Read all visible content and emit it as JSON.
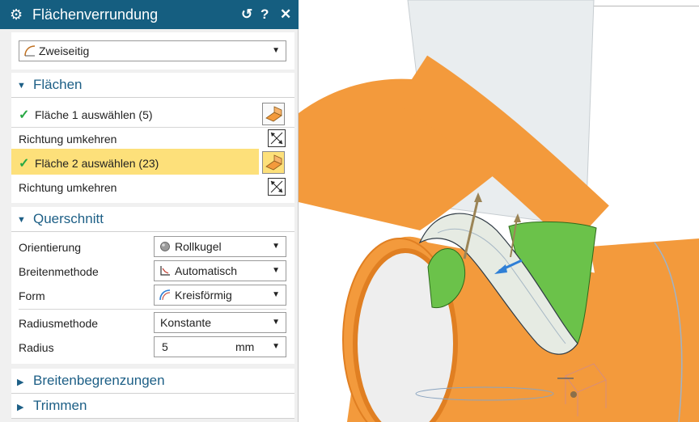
{
  "dialog": {
    "title": "Flächenverrundung",
    "icons": {
      "app": "gear-icon",
      "reset": "reset-icon",
      "help": "help-icon",
      "close": "close-icon"
    },
    "title_buttons": {
      "reset": "↺",
      "help": "?",
      "close": "✕"
    },
    "type_dropdown": {
      "value": "Zweiseitig"
    }
  },
  "faces": {
    "header": "Flächen",
    "face1_label": "Fläche 1 auswählen (5)",
    "reverse1_label": "Richtung umkehren",
    "face2_label": "Fläche 2 auswählen (23)",
    "reverse2_label": "Richtung umkehren"
  },
  "cross_section": {
    "header": "Querschnitt",
    "orientation": {
      "label": "Orientierung",
      "value": "Rollkugel"
    },
    "width_method": {
      "label": "Breitenmethode",
      "value": "Automatisch"
    },
    "shape": {
      "label": "Form",
      "value": "Kreisförmig"
    },
    "radius_method": {
      "label": "Radiusmethode",
      "value": "Konstante"
    },
    "radius": {
      "label": "Radius",
      "value": "5",
      "unit": "mm"
    }
  },
  "collapsed_sections": {
    "width_limits": "Breitenbegrenzungen",
    "trim": "Trimmen"
  },
  "colors": {
    "title_bar": "#155e80",
    "accent_text": "#1d5f86",
    "selected_row": "#fde07a",
    "check": "#27a844",
    "tube_orange": "#f39a3c",
    "face_green": "#6bc24a"
  }
}
